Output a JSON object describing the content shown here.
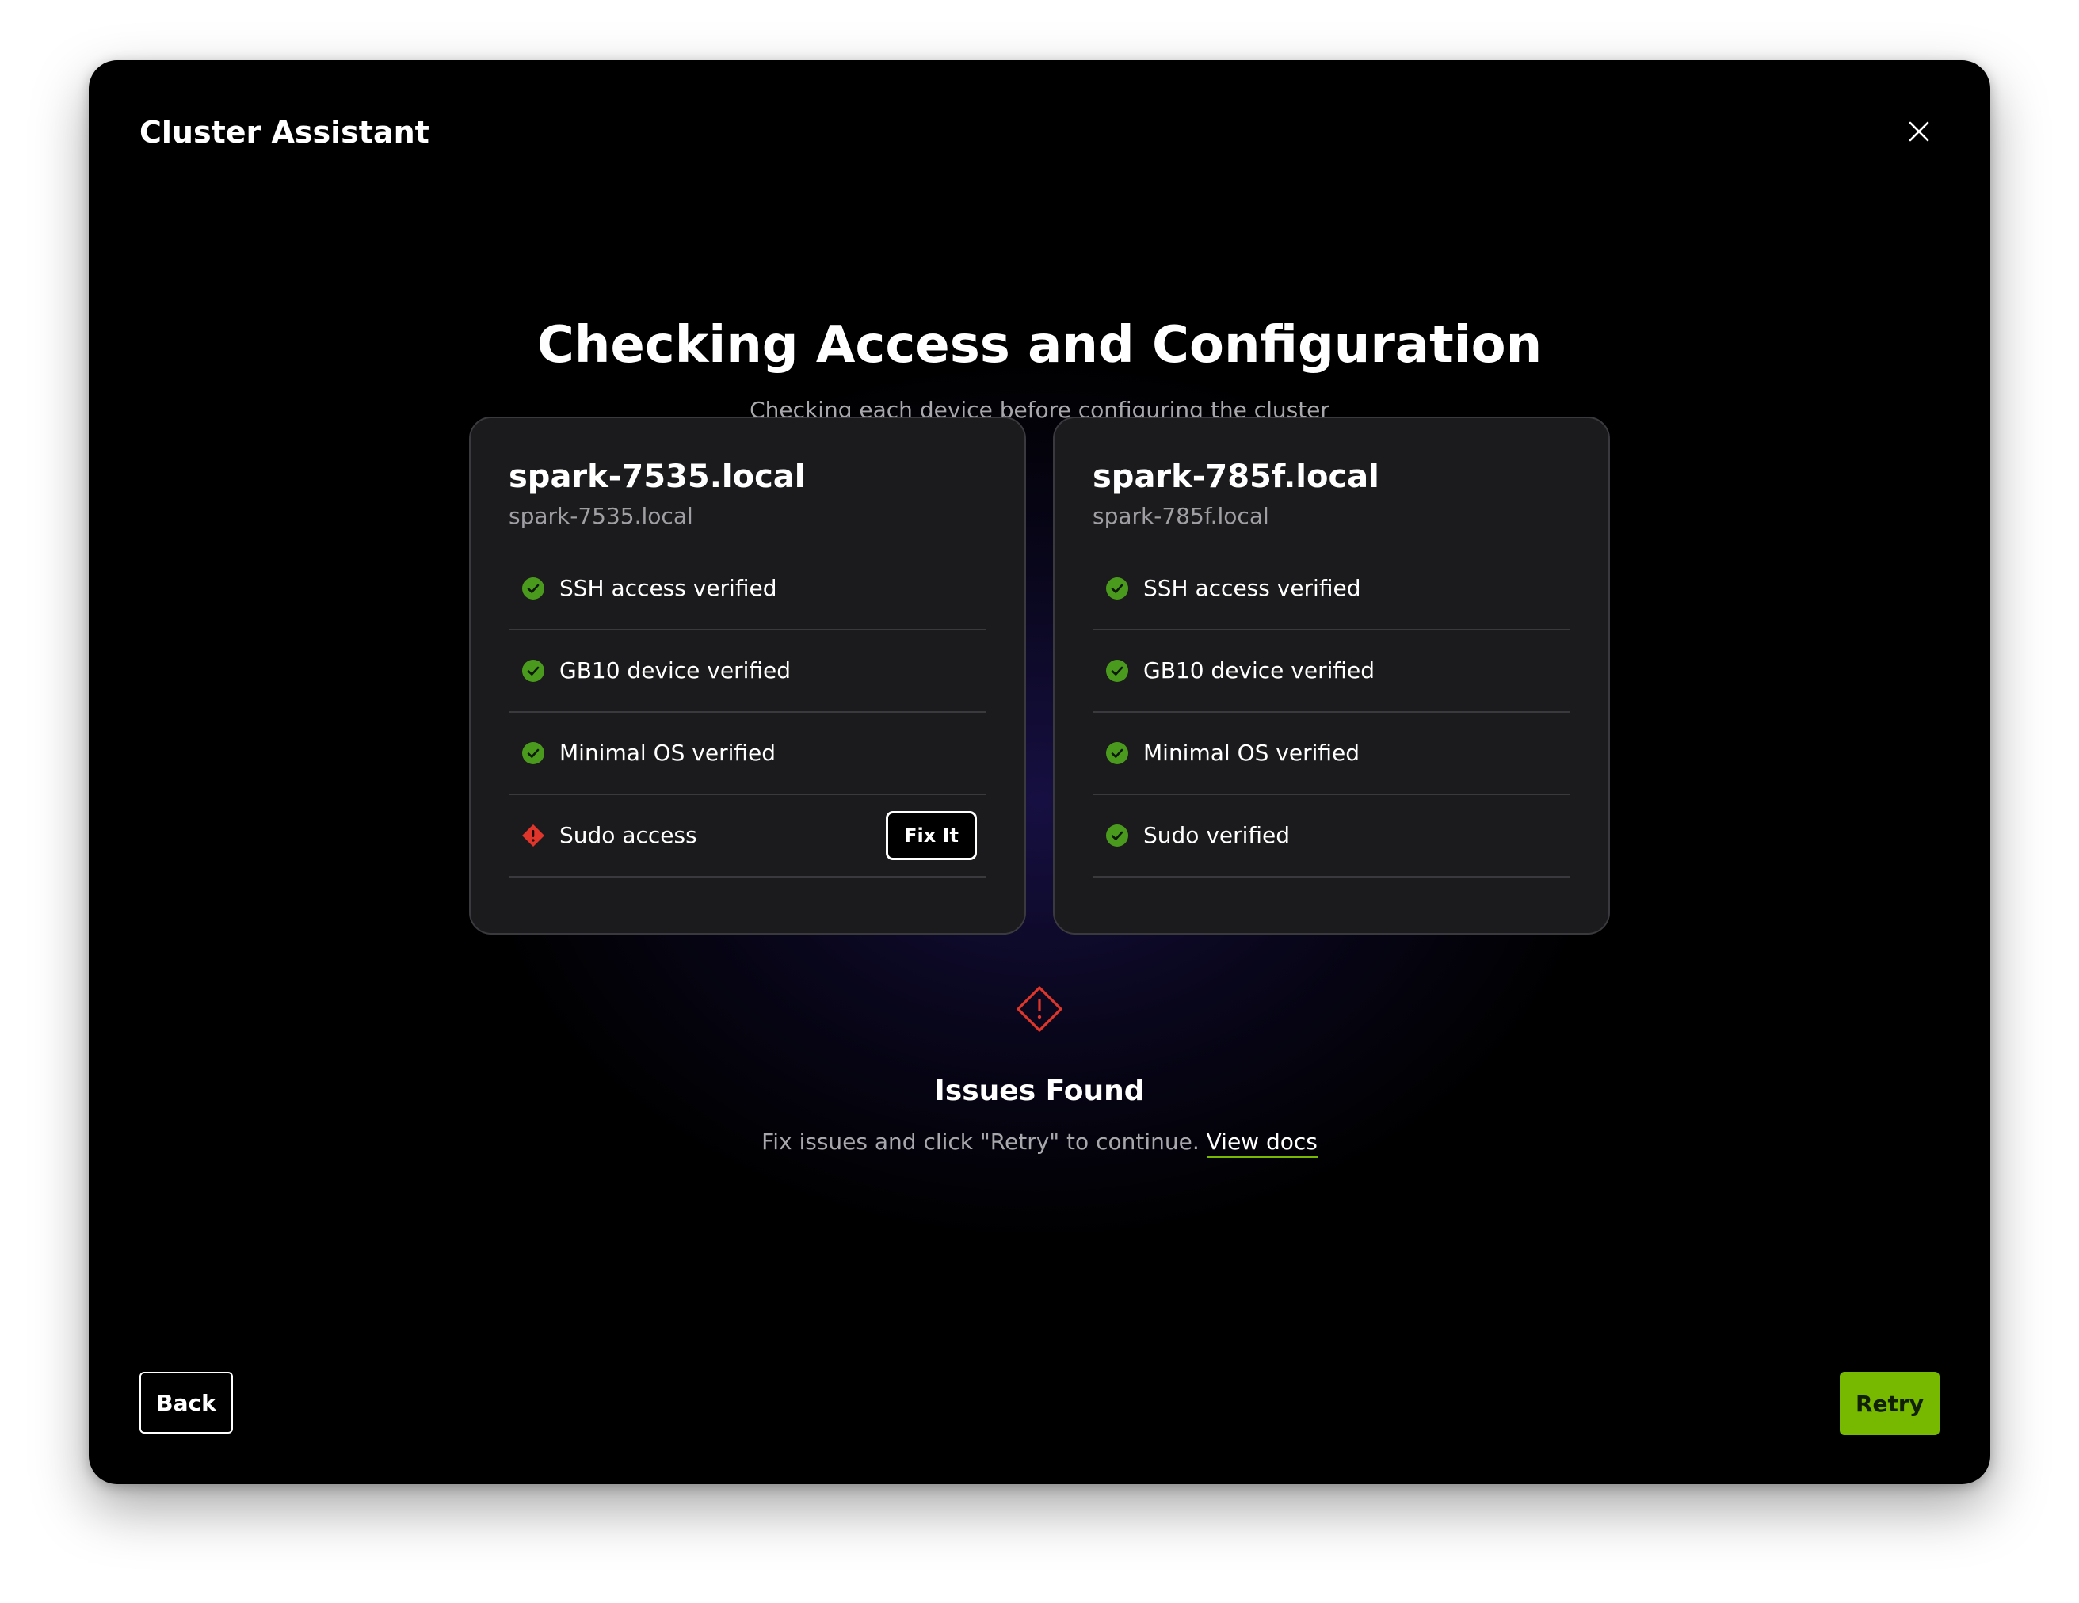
{
  "window": {
    "title": "Cluster Assistant"
  },
  "main": {
    "heading": "Checking Access and Configuration",
    "subheading": "Checking each device before configuring the cluster"
  },
  "devices": [
    {
      "name": "spark-7535.local",
      "host": "spark-7535.local",
      "checks": [
        {
          "label": "SSH access verified",
          "status": "success"
        },
        {
          "label": "GB10 device verified",
          "status": "success"
        },
        {
          "label": "Minimal OS verified",
          "status": "success"
        },
        {
          "label": "Sudo access",
          "status": "error",
          "action_label": "Fix It"
        }
      ]
    },
    {
      "name": "spark-785f.local",
      "host": "spark-785f.local",
      "checks": [
        {
          "label": "SSH access verified",
          "status": "success"
        },
        {
          "label": "GB10 device verified",
          "status": "success"
        },
        {
          "label": "Minimal OS verified",
          "status": "success"
        },
        {
          "label": "Sudo verified",
          "status": "success"
        }
      ]
    }
  ],
  "issues": {
    "icon": "warning-diamond-icon",
    "title": "Issues Found",
    "message": "Fix issues and click \"Retry\" to continue.",
    "link_label": "View docs"
  },
  "footer": {
    "back_label": "Back",
    "retry_label": "Retry"
  },
  "colors": {
    "accent": "#76b900",
    "success": "#4a9a1e",
    "error": "#e0352b",
    "background": "#000000",
    "card": "#1b1b1d"
  }
}
